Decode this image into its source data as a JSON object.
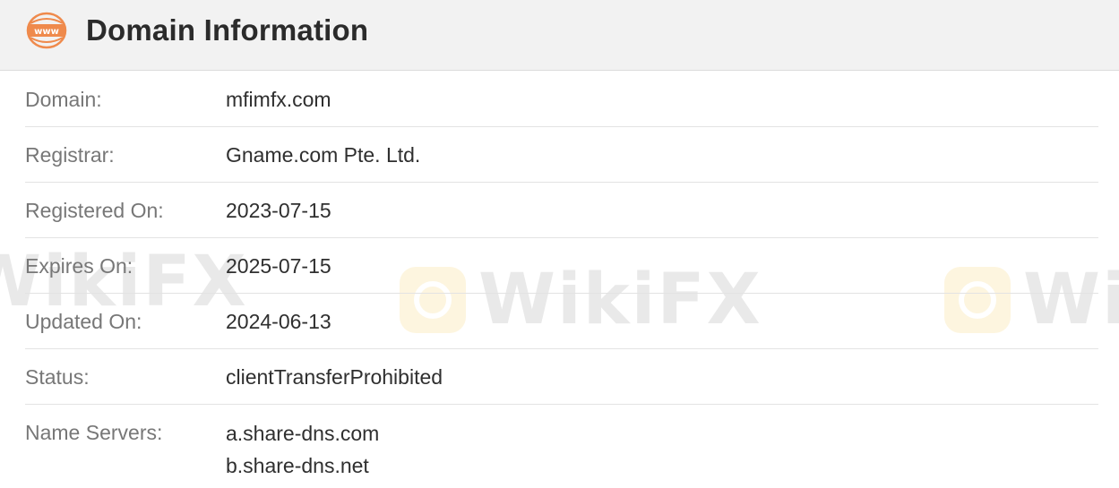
{
  "header": {
    "icon": "www-globe-icon",
    "icon_text": "www",
    "title": "Domain Information"
  },
  "rows": [
    {
      "label": "Domain:",
      "value": "mfimfx.com"
    },
    {
      "label": "Registrar:",
      "value": "Gname.com Pte. Ltd."
    },
    {
      "label": "Registered On:",
      "value": "2023-07-15"
    },
    {
      "label": "Expires On:",
      "value": "2025-07-15"
    },
    {
      "label": "Updated On:",
      "value": "2024-06-13"
    },
    {
      "label": "Status:",
      "value": "clientTransferProhibited"
    },
    {
      "label": "Name Servers:",
      "values": [
        "a.share-dns.com",
        "b.share-dns.net"
      ]
    }
  ],
  "watermark": {
    "text": "WikiFX",
    "color": "#f0b400"
  },
  "colors": {
    "header_bg": "#f2f2f2",
    "icon_accent": "#ef8a4c",
    "label": "#777777",
    "value": "#2f2f2f",
    "divider": "#e3e3e3"
  }
}
